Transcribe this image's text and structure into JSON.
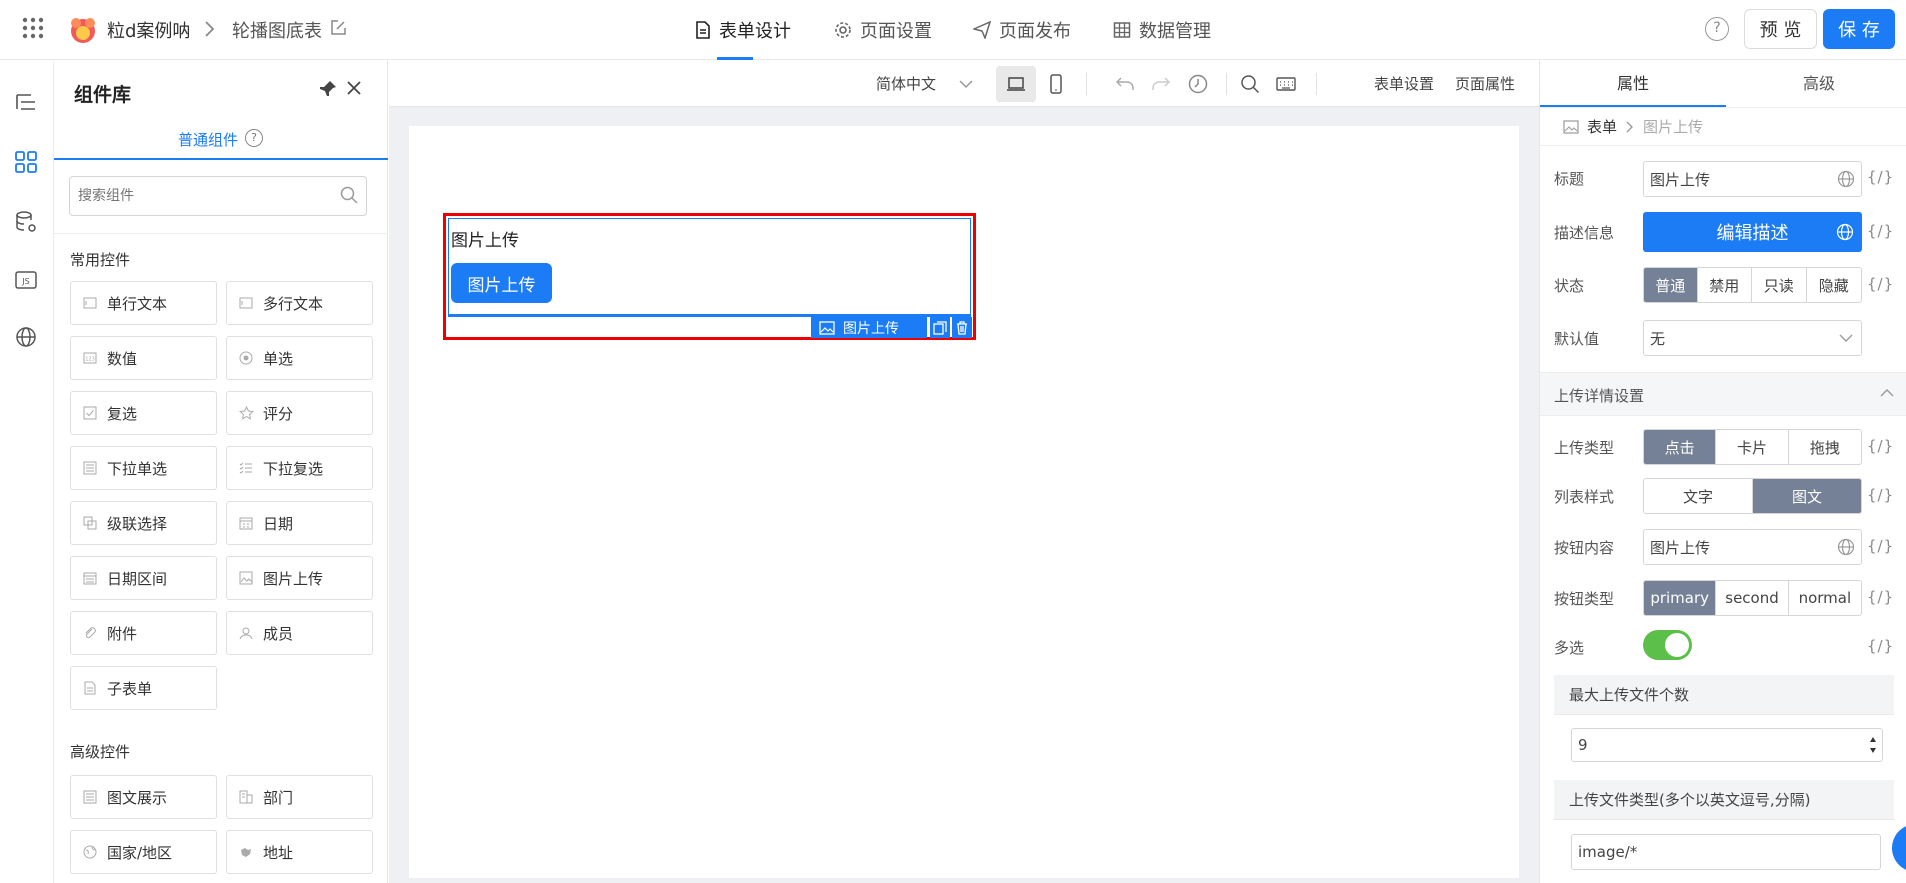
{
  "header": {
    "app_name": "粒d案例呐",
    "page_name": "轮播图底表",
    "tabs": [
      {
        "label": "表单设计",
        "icon": "document-icon",
        "active": true
      },
      {
        "label": "页面设置",
        "icon": "gear-icon",
        "active": false
      },
      {
        "label": "页面发布",
        "icon": "send-icon",
        "active": false
      },
      {
        "label": "数据管理",
        "icon": "table-grid-icon",
        "active": false
      }
    ],
    "help": "?",
    "preview_label": "预 览",
    "save_label": "保 存",
    "accent": "#1b7cf5"
  },
  "library": {
    "title": "组件库",
    "tab_label": "普通组件",
    "search_placeholder": "搜索组件",
    "common_title": "常用控件",
    "common": [
      {
        "label": "单行文本",
        "icon": "single-line-text-icon"
      },
      {
        "label": "多行文本",
        "icon": "multi-line-text-icon"
      },
      {
        "label": "数值",
        "icon": "number-icon"
      },
      {
        "label": "单选",
        "icon": "radio-icon"
      },
      {
        "label": "复选",
        "icon": "checkbox-icon"
      },
      {
        "label": "评分",
        "icon": "star-icon"
      },
      {
        "label": "下拉单选",
        "icon": "dropdown-single-icon"
      },
      {
        "label": "下拉复选",
        "icon": "dropdown-multi-icon"
      },
      {
        "label": "级联选择",
        "icon": "cascade-icon"
      },
      {
        "label": "日期",
        "icon": "calendar-icon"
      },
      {
        "label": "日期区间",
        "icon": "date-range-icon"
      },
      {
        "label": "图片上传",
        "icon": "image-upload-icon"
      },
      {
        "label": "附件",
        "icon": "attachment-icon"
      },
      {
        "label": "成员",
        "icon": "member-icon"
      },
      {
        "label": "子表单",
        "icon": "subform-icon"
      }
    ],
    "advanced_title": "高级控件",
    "advanced": [
      {
        "label": "图文展示",
        "icon": "rich-text-icon"
      },
      {
        "label": "部门",
        "icon": "department-icon"
      },
      {
        "label": "国家/地区",
        "icon": "globe-icon"
      },
      {
        "label": "地址",
        "icon": "map-icon"
      }
    ]
  },
  "canvas_toolbar": {
    "language": "简体中文",
    "form_settings": "表单设置",
    "page_props": "页面属性"
  },
  "canvas": {
    "field_label": "图片上传",
    "upload_button": "图片上传",
    "selected_tag": "图片上传"
  },
  "props": {
    "tab_attr": "属性",
    "tab_advanced": "高级",
    "breadcrumb_root": "表单",
    "breadcrumb_current": "图片上传",
    "title_label": "标题",
    "title_value": "图片上传",
    "desc_label": "描述信息",
    "desc_button": "编辑描述",
    "state_label": "状态",
    "state_options": [
      "普通",
      "禁用",
      "只读",
      "隐藏"
    ],
    "state_selected": 0,
    "default_label": "默认值",
    "default_value": "无",
    "upload_section": "上传详情设置",
    "upload_type_label": "上传类型",
    "upload_type_options": [
      "点击",
      "卡片",
      "拖拽"
    ],
    "upload_type_selected": 0,
    "list_style_label": "列表样式",
    "list_style_options": [
      "文字",
      "图文"
    ],
    "list_style_selected": 1,
    "btn_content_label": "按钮内容",
    "btn_content_value": "图片上传",
    "btn_type_label": "按钮类型",
    "btn_type_options": [
      "primary",
      "second",
      "normal"
    ],
    "btn_type_selected": 0,
    "multi_label": "多选",
    "multi_on": true,
    "max_files_label": "最大上传文件个数",
    "max_files_value": "9",
    "file_types_label": "上传文件类型(多个以英文逗号,分隔)",
    "file_types_value": "image/*",
    "fx": "{/}"
  }
}
